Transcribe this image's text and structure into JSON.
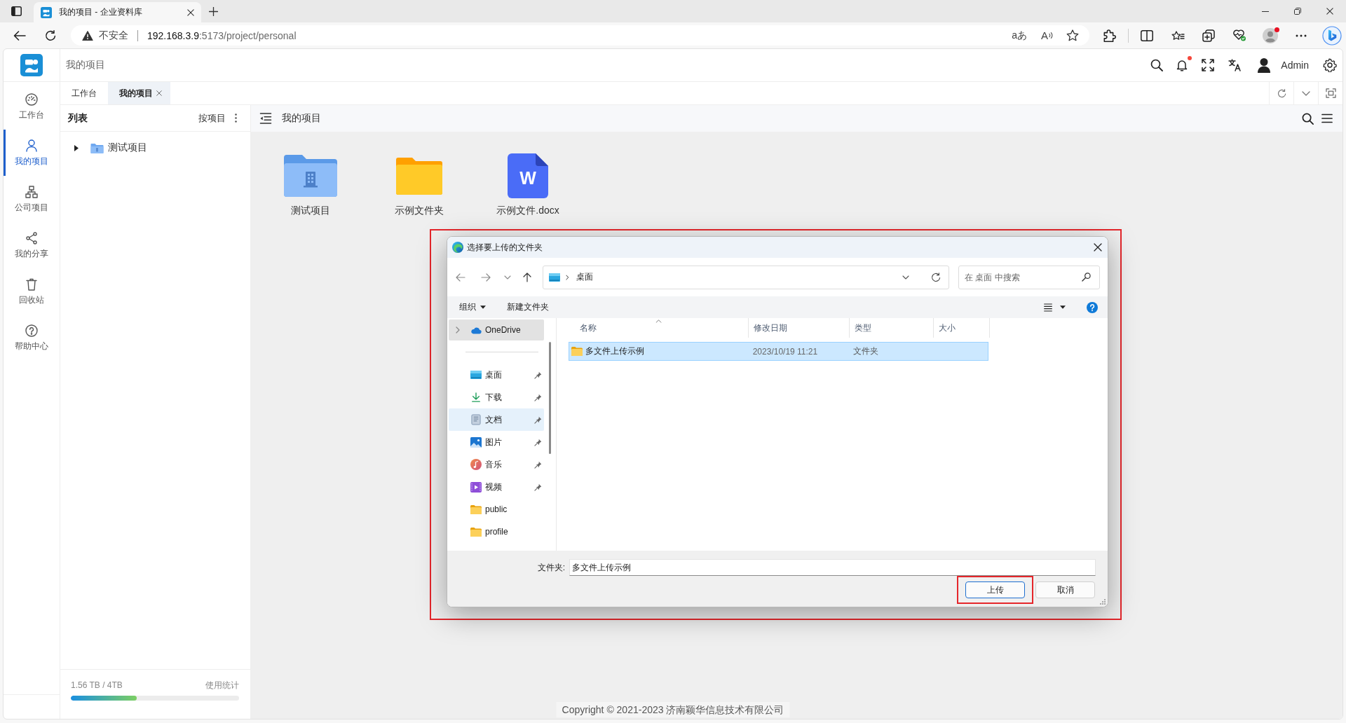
{
  "browser": {
    "tabs": [
      {
        "title": "我的项目 - 企业资料库",
        "selected": true
      }
    ],
    "security": "不安全",
    "url": {
      "host": "192.168.3.9",
      "path": ":5173/project/personal"
    },
    "address_actions": [
      {
        "kind": "translate",
        "glyph": "aあ"
      },
      {
        "kind": "read_aloud",
        "glyph": "A"
      },
      {
        "kind": "favorite"
      }
    ],
    "profile_alert": true
  },
  "app": {
    "breadcrumb": "我的项目",
    "notification_dot": true,
    "user": "Admin",
    "nav": [
      {
        "kind": "dashboard",
        "label": "工作台",
        "selected": false
      },
      {
        "kind": "user",
        "label": "我的项目",
        "selected": true
      },
      {
        "kind": "org",
        "label": "公司项目",
        "selected": false
      },
      {
        "kind": "share",
        "label": "我的分享",
        "selected": false
      },
      {
        "kind": "trash",
        "label": "回收站",
        "selected": false
      },
      {
        "kind": "help",
        "label": "帮助中心",
        "selected": false
      }
    ],
    "page_tabs": [
      {
        "label": "工作台",
        "selected": false,
        "closable": false
      },
      {
        "label": "我的项目",
        "selected": true,
        "closable": true
      }
    ],
    "tree": {
      "title": "列表",
      "group_by": "按项目",
      "items": [
        {
          "label": "测试项目",
          "expanded": false
        }
      ]
    },
    "storage": {
      "usage": "1.56 TB / 4TB",
      "link": "使用统计",
      "level": 0.39
    },
    "toolbar_title": "我的项目",
    "files": [
      {
        "kind": "project",
        "name": "测试项目"
      },
      {
        "kind": "folder",
        "name": "示例文件夹"
      },
      {
        "kind": "word",
        "name": "示例文件.docx",
        "glyph": "W"
      }
    ],
    "copyright": "Copyright © 2021-2023 济南颖华信息技术有限公司"
  },
  "dialog": {
    "title": "选择要上传的文件夹",
    "highlighted": true,
    "location": "桌面",
    "search_placeholder": "在 桌面 中搜索",
    "commands": [
      {
        "label": "组织",
        "dropdown": true
      },
      {
        "label": "新建文件夹",
        "dropdown": false
      }
    ],
    "nav_pane": [
      {
        "kind": "onedrive",
        "label": "OneDrive",
        "selected": true,
        "hovered": false,
        "pinned": false,
        "expandable": true
      },
      {
        "kind": "desktop",
        "label": "桌面",
        "selected": false,
        "hovered": false,
        "pinned": true,
        "expandable": false
      },
      {
        "kind": "downloads",
        "label": "下载",
        "selected": false,
        "hovered": false,
        "pinned": true,
        "expandable": false
      },
      {
        "kind": "documents",
        "label": "文档",
        "selected": false,
        "hovered": true,
        "pinned": true,
        "expandable": false
      },
      {
        "kind": "pictures",
        "label": "图片",
        "selected": false,
        "hovered": false,
        "pinned": true,
        "expandable": false
      },
      {
        "kind": "music",
        "label": "音乐",
        "selected": false,
        "hovered": false,
        "pinned": true,
        "expandable": false
      },
      {
        "kind": "videos",
        "label": "视频",
        "selected": false,
        "hovered": false,
        "pinned": true,
        "expandable": false
      },
      {
        "kind": "folder",
        "label": "public",
        "selected": false,
        "hovered": false,
        "pinned": false,
        "expandable": false
      },
      {
        "kind": "folder",
        "label": "profile",
        "selected": false,
        "hovered": false,
        "pinned": false,
        "expandable": false
      }
    ],
    "columns": [
      {
        "label": "名称",
        "sorted": true
      },
      {
        "label": "修改日期",
        "sorted": false
      },
      {
        "label": "类型",
        "sorted": false
      },
      {
        "label": "大小",
        "sorted": false
      }
    ],
    "rows": [
      {
        "name": "多文件上传示例",
        "modified": "2023/10/19 11:21",
        "type": "文件夹",
        "selected": true
      }
    ],
    "folder_label": "文件夹:",
    "folder_value": "多文件上传示例",
    "buttons": [
      {
        "label": "上传",
        "default": true,
        "highlighted": true
      },
      {
        "label": "取消",
        "default": false,
        "highlighted": false
      }
    ]
  }
}
